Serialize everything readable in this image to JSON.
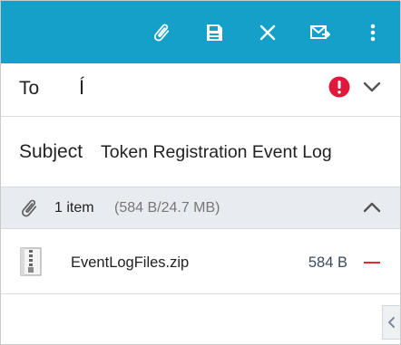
{
  "recipients": {
    "label": "To",
    "value": "Í"
  },
  "subject": {
    "label": "Subject",
    "value": "Token Registration Event Log"
  },
  "attachments": {
    "count_text": "1 item",
    "size_text": "(584 B/24.7 MB)",
    "items": [
      {
        "name": "EventLogFiles.zip",
        "size": "584 B"
      }
    ]
  },
  "icons": {
    "toolbar": [
      "paperclip-icon",
      "save-icon",
      "close-icon",
      "send-mail-icon",
      "more-vertical-icon"
    ],
    "recipients": [
      "error-icon",
      "chevron-down-icon"
    ],
    "attachments": [
      "paperclip-icon",
      "chevron-up-icon",
      "zip-file-icon",
      "remove-icon"
    ],
    "side": [
      "chevron-left-icon"
    ]
  },
  "colors": {
    "toolbar": "#14a0c8",
    "error": "#e0183c",
    "remove": "#e22b2b",
    "attach_header_bg": "#e8ecf1"
  }
}
